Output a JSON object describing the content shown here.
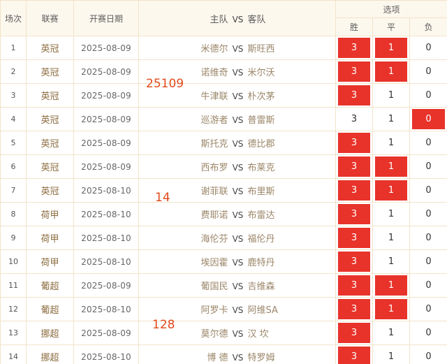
{
  "headers": {
    "index": "场次",
    "league": "联赛",
    "date": "开赛日期",
    "match_home": "主队",
    "match_vs": "VS",
    "match_away": "客队",
    "options": "选项",
    "win": "胜",
    "draw": "平",
    "loss": "负"
  },
  "option_labels": [
    "3",
    "1",
    "0"
  ],
  "selected_color": "#e8332a",
  "notes": [
    "25109",
    "14",
    "128"
  ],
  "rows": [
    {
      "index": "1",
      "league": "英冠",
      "date": "2025-08-09",
      "home": "米德尔",
      "vs": "VS",
      "away": "斯旺西",
      "selected": [
        true,
        true,
        false
      ]
    },
    {
      "index": "2",
      "league": "英冠",
      "date": "2025-08-09",
      "home": "诺维奇",
      "vs": "VS",
      "away": "米尔沃",
      "selected": [
        true,
        true,
        false
      ]
    },
    {
      "index": "3",
      "league": "英冠",
      "date": "2025-08-09",
      "home": "牛津联",
      "vs": "VS",
      "away": "朴次茅",
      "selected": [
        true,
        false,
        false
      ]
    },
    {
      "index": "4",
      "league": "英冠",
      "date": "2025-08-09",
      "home": "巡游者",
      "vs": "VS",
      "away": "普雷斯",
      "selected": [
        false,
        false,
        true
      ]
    },
    {
      "index": "5",
      "league": "英冠",
      "date": "2025-08-09",
      "home": "斯托克",
      "vs": "VS",
      "away": "德比郡",
      "selected": [
        true,
        false,
        false
      ]
    },
    {
      "index": "6",
      "league": "英冠",
      "date": "2025-08-09",
      "home": "西布罗",
      "vs": "VS",
      "away": "布莱克",
      "selected": [
        true,
        true,
        false
      ]
    },
    {
      "index": "7",
      "league": "英冠",
      "date": "2025-08-10",
      "home": "谢菲联",
      "vs": "VS",
      "away": "布里斯",
      "selected": [
        true,
        true,
        false
      ]
    },
    {
      "index": "8",
      "league": "荷甲",
      "date": "2025-08-10",
      "home": "费耶诺",
      "vs": "VS",
      "away": "布雷达",
      "selected": [
        true,
        false,
        false
      ]
    },
    {
      "index": "9",
      "league": "荷甲",
      "date": "2025-08-10",
      "home": "海伦芬",
      "vs": "VS",
      "away": "福伦丹",
      "selected": [
        true,
        false,
        false
      ]
    },
    {
      "index": "10",
      "league": "荷甲",
      "date": "2025-08-10",
      "home": "埃因霍",
      "vs": "VS",
      "away": "鹿特丹",
      "selected": [
        true,
        false,
        false
      ]
    },
    {
      "index": "11",
      "league": "葡超",
      "date": "2025-08-09",
      "home": "葡国民",
      "vs": "VS",
      "away": "吉维森",
      "selected": [
        true,
        true,
        false
      ]
    },
    {
      "index": "12",
      "league": "葡超",
      "date": "2025-08-10",
      "home": "阿罗卡",
      "vs": "VS",
      "away": "阿维SA",
      "selected": [
        true,
        true,
        false
      ]
    },
    {
      "index": "13",
      "league": "挪超",
      "date": "2025-08-09",
      "home": "莫尔德",
      "vs": "VS",
      "away": "汉 坎",
      "selected": [
        true,
        false,
        false
      ]
    },
    {
      "index": "14",
      "league": "挪超",
      "date": "2025-08-10",
      "home": "博 德",
      "vs": "VS",
      "away": "特罗姆",
      "selected": [
        true,
        false,
        false
      ]
    }
  ]
}
